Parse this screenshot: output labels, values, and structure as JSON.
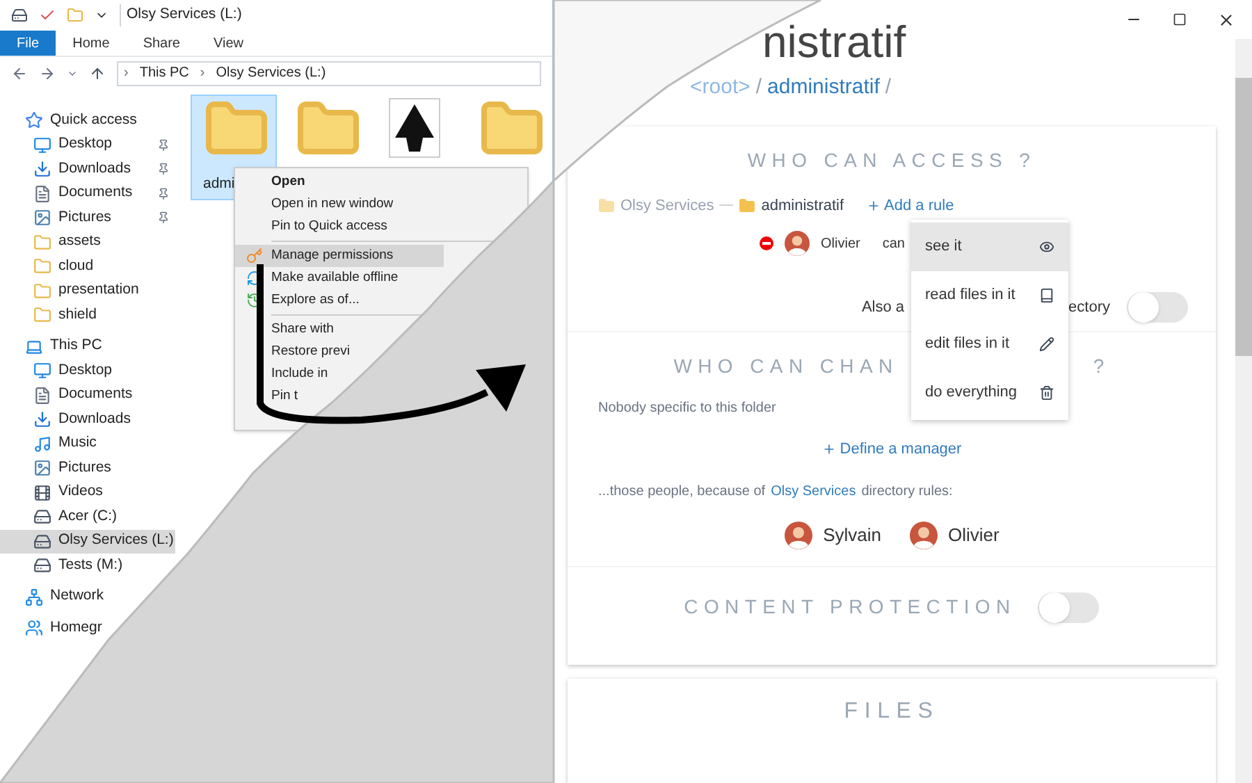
{
  "explorer": {
    "title": "Olsy Services (L:)",
    "ribbon_tabs": [
      {
        "label": "File",
        "selected": true
      },
      {
        "label": "Home",
        "selected": false
      },
      {
        "label": "Share",
        "selected": false
      },
      {
        "label": "View",
        "selected": false
      }
    ],
    "address": [
      {
        "separator": "›",
        "label": "This PC"
      },
      {
        "separator": "›",
        "label": "Olsy Services (L:)"
      }
    ],
    "nav": [
      {
        "label": "Quick access",
        "kind": "star",
        "children": [
          {
            "label": "Desktop",
            "kind": "desktop",
            "pinned": true
          },
          {
            "label": "Downloads",
            "kind": "download",
            "pinned": true
          },
          {
            "label": "Documents",
            "kind": "document",
            "pinned": true
          },
          {
            "label": "Pictures",
            "kind": "picture",
            "pinned": true
          },
          {
            "label": "assets",
            "kind": "folder",
            "pinned": false
          },
          {
            "label": "cloud",
            "kind": "folder",
            "pinned": false
          },
          {
            "label": "presentation",
            "kind": "folder",
            "pinned": false
          },
          {
            "label": "shield",
            "kind": "folder",
            "pinned": false
          }
        ]
      },
      {
        "label": "This PC",
        "kind": "pc",
        "children": [
          {
            "label": "Desktop",
            "kind": "desktop",
            "selected": false
          },
          {
            "label": "Documents",
            "kind": "document",
            "selected": false
          },
          {
            "label": "Downloads",
            "kind": "download",
            "selected": false
          },
          {
            "label": "Music",
            "kind": "music",
            "selected": false
          },
          {
            "label": "Pictures",
            "kind": "picture",
            "selected": false
          },
          {
            "label": "Videos",
            "kind": "video",
            "selected": false
          },
          {
            "label": "Acer (C:)",
            "kind": "drive",
            "selected": false
          },
          {
            "label": "Olsy Services (L:)",
            "kind": "drive",
            "selected": true
          },
          {
            "label": "Tests (M:)",
            "kind": "drive",
            "selected": false
          }
        ]
      },
      {
        "label": "Network",
        "kind": "network"
      },
      {
        "label": "Homegr",
        "kind": "homegroup"
      }
    ],
    "items": [
      {
        "label": "admi",
        "kind": "folder",
        "selected": true
      },
      {
        "kind": "folder",
        "selected": false
      },
      {
        "kind": "app",
        "selected": false
      },
      {
        "kind": "folder",
        "selected": false
      }
    ],
    "context_menu": [
      {
        "label": "Open",
        "kind": "plain",
        "default": true,
        "selected": false
      },
      {
        "label": "Open in new window",
        "kind": "plain",
        "default": false,
        "selected": false
      },
      {
        "label": "Pin to Quick access",
        "kind": "plain",
        "default": false,
        "selected": false
      },
      {
        "kind": "separator"
      },
      {
        "label": "Manage permissions",
        "kind": "key",
        "default": false,
        "selected": true
      },
      {
        "label": "Make available offline",
        "kind": "sync",
        "default": false,
        "selected": false
      },
      {
        "label": "Explore as of...",
        "kind": "history",
        "default": false,
        "selected": false
      },
      {
        "kind": "separator"
      },
      {
        "label": "Share with",
        "kind": "plain",
        "default": false,
        "selected": false
      },
      {
        "label": "Restore previ",
        "kind": "plain",
        "default": false,
        "selected": false
      },
      {
        "label": "Include in",
        "kind": "plain",
        "default": false,
        "selected": false
      },
      {
        "label": "Pin t",
        "kind": "plain",
        "default": false,
        "selected": false
      }
    ]
  },
  "app": {
    "title": "nistratif",
    "breadcrumb": [
      {
        "label": "<root>",
        "current": false,
        "separator": "/"
      },
      {
        "label": "administratif",
        "current": true,
        "separator": "/"
      }
    ],
    "access": {
      "heading": "WHO CAN ACCESS ?",
      "path": [
        {
          "label": "Olsy Services",
          "inherited": true
        },
        {
          "label": "administratif",
          "inherited": false
        }
      ],
      "add_rule": "Add a rule",
      "rule": {
        "user": "Olivier",
        "verb": "can"
      },
      "options": [
        {
          "label": "see it",
          "kind": "see",
          "selected": true
        },
        {
          "label": "read files in it",
          "kind": "read",
          "selected": false
        },
        {
          "label": "edit files in it",
          "kind": "edit",
          "selected": false
        },
        {
          "label": "do everything",
          "kind": "all",
          "selected": false
        }
      ],
      "also_start": "Also a",
      "also_end": "ectory",
      "also_on": false
    },
    "change": {
      "heading": "WHO CAN CHAN",
      "heading_end": "?",
      "note": "Nobody specific to this folder",
      "define": "Define a manager",
      "inherited_before": "...those people, because of",
      "inherited_link": "Olsy Services",
      "inherited_after": "directory rules:",
      "managers": [
        "Sylvain",
        "Olivier"
      ]
    },
    "protection": {
      "heading": "CONTENT PROTECTION",
      "on": false
    },
    "files": {
      "heading": "FILES"
    }
  }
}
